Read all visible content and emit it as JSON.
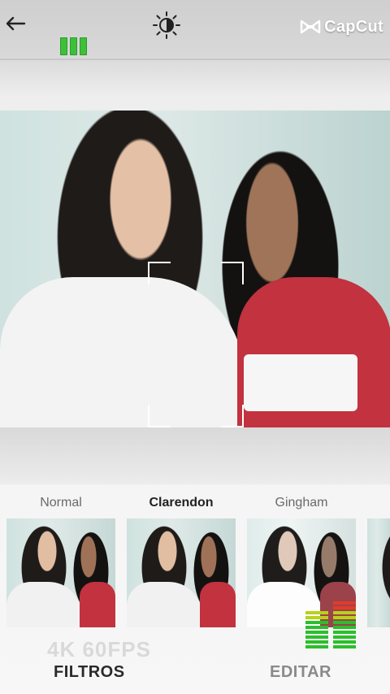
{
  "header": {
    "brand": "CapCut",
    "icons": {
      "back": "arrow-left-icon",
      "brightness": "brightness-icon",
      "battery": "battery-icon"
    }
  },
  "filters": {
    "labels": [
      "Normal",
      "Clarendon",
      "Gingham"
    ],
    "selected": "Clarendon"
  },
  "overlay": {
    "watermark": "4K 60FPS"
  },
  "tabs": {
    "filtros": "FILTROS",
    "editar": "EDITAR"
  },
  "colors": {
    "accent_green": "#3fbf3a",
    "shirt_red": "#c2323f"
  }
}
